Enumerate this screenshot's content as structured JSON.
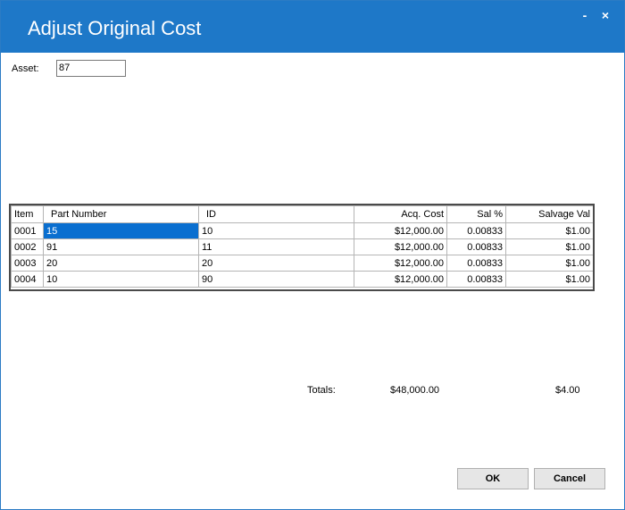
{
  "window": {
    "title": "Adjust Original Cost",
    "minimize_label": "-",
    "close_label": "×"
  },
  "asset": {
    "label": "Asset:",
    "value": "87"
  },
  "grid": {
    "columns": [
      "Item",
      "Part Number",
      "ID",
      "Acq. Cost",
      "Sal %",
      "Salvage Val"
    ],
    "rows": [
      {
        "item": "0001",
        "part_number": "15",
        "id": "10",
        "acq_cost": "$12,000.00",
        "sal_pct": "0.00833",
        "salvage_val": "$1.00"
      },
      {
        "item": "0002",
        "part_number": "91",
        "id": "11",
        "acq_cost": "$12,000.00",
        "sal_pct": "0.00833",
        "salvage_val": "$1.00"
      },
      {
        "item": "0003",
        "part_number": "20",
        "id": "20",
        "acq_cost": "$12,000.00",
        "sal_pct": "0.00833",
        "salvage_val": "$1.00"
      },
      {
        "item": "0004",
        "part_number": "10",
        "id": "90",
        "acq_cost": "$12,000.00",
        "sal_pct": "0.00833",
        "salvage_val": "$1.00"
      }
    ],
    "selection_color": "#0a6fd0"
  },
  "totals": {
    "label": "Totals:",
    "acq_cost": "$48,000.00",
    "salvage_val": "$4.00"
  },
  "buttons": {
    "ok": "OK",
    "cancel": "Cancel"
  },
  "colors": {
    "titlebar": "#1e78c8"
  }
}
